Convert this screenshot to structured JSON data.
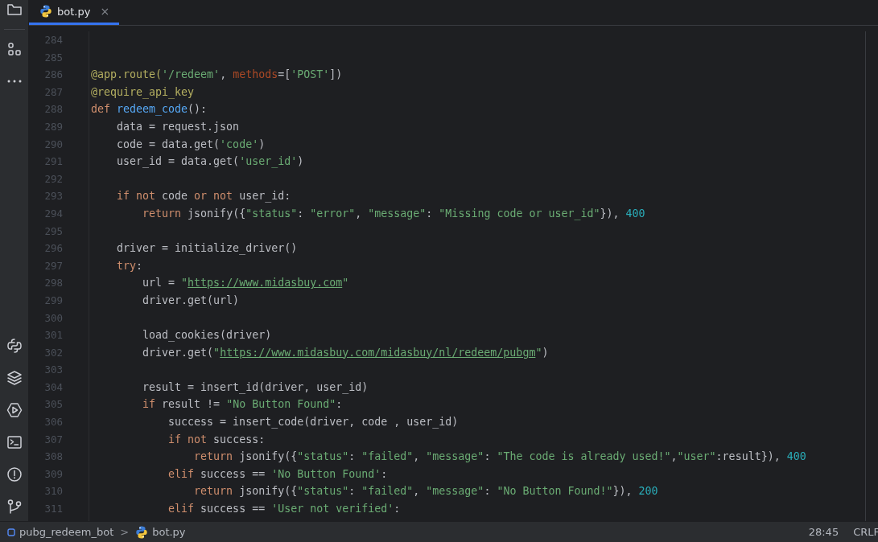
{
  "tabs": [
    {
      "label": "bot.py",
      "selected": true,
      "close": "×"
    }
  ],
  "editor": {
    "lines": [
      {
        "number": "284"
      },
      {
        "number": "285"
      },
      {
        "number": "286",
        "tokens": [
          {
            "kind": "deco",
            "text": "@app.route("
          },
          {
            "kind": "str",
            "text": "'/redeem'"
          },
          {
            "kind": "plain",
            "text": ", "
          },
          {
            "kind": "param",
            "text": "methods"
          },
          {
            "kind": "plain",
            "text": "=["
          },
          {
            "kind": "str",
            "text": "'POST'"
          },
          {
            "kind": "plain",
            "text": "])"
          }
        ]
      },
      {
        "number": "287",
        "tokens": [
          {
            "kind": "deco",
            "text": "@require_api_key"
          }
        ]
      },
      {
        "number": "288",
        "tokens": [
          {
            "kind": "kw",
            "text": "def "
          },
          {
            "kind": "fn",
            "text": "redeem_code"
          },
          {
            "kind": "plain",
            "text": "():"
          }
        ]
      },
      {
        "number": "289",
        "tokens": [
          {
            "kind": "plain",
            "text": "    data = request.json"
          }
        ]
      },
      {
        "number": "290",
        "tokens": [
          {
            "kind": "plain",
            "text": "    code = data.get("
          },
          {
            "kind": "str",
            "text": "'code'"
          },
          {
            "kind": "plain",
            "text": ")"
          }
        ]
      },
      {
        "number": "291",
        "tokens": [
          {
            "kind": "plain",
            "text": "    user_id = data.get("
          },
          {
            "kind": "str",
            "text": "'user_id'"
          },
          {
            "kind": "plain",
            "text": ")"
          }
        ]
      },
      {
        "number": "292"
      },
      {
        "number": "293",
        "tokens": [
          {
            "kind": "kw",
            "text": "    if not "
          },
          {
            "kind": "plain",
            "text": "code "
          },
          {
            "kind": "kw",
            "text": "or not "
          },
          {
            "kind": "plain",
            "text": "user_id:"
          }
        ]
      },
      {
        "number": "294",
        "tokens": [
          {
            "kind": "kw",
            "text": "        return "
          },
          {
            "kind": "plain",
            "text": "jsonify({"
          },
          {
            "kind": "str",
            "text": "\"status\""
          },
          {
            "kind": "plain",
            "text": ": "
          },
          {
            "kind": "str",
            "text": "\"error\""
          },
          {
            "kind": "plain",
            "text": ", "
          },
          {
            "kind": "str",
            "text": "\"message\""
          },
          {
            "kind": "plain",
            "text": ": "
          },
          {
            "kind": "str",
            "text": "\"Missing code or user_id\""
          },
          {
            "kind": "plain",
            "text": "}), "
          },
          {
            "kind": "num",
            "text": "400"
          }
        ]
      },
      {
        "number": "295"
      },
      {
        "number": "296",
        "tokens": [
          {
            "kind": "plain",
            "text": "    driver = initialize_driver()"
          }
        ]
      },
      {
        "number": "297",
        "tokens": [
          {
            "kind": "kw",
            "text": "    try"
          },
          {
            "kind": "plain",
            "text": ":"
          }
        ]
      },
      {
        "number": "298",
        "tokens": [
          {
            "kind": "plain",
            "text": "        url = "
          },
          {
            "kind": "str",
            "text": "\""
          },
          {
            "kind": "url",
            "text": "https://www.midasbuy.com"
          },
          {
            "kind": "str",
            "text": "\""
          }
        ]
      },
      {
        "number": "299",
        "tokens": [
          {
            "kind": "plain",
            "text": "        driver.get(url)"
          }
        ]
      },
      {
        "number": "300"
      },
      {
        "number": "301",
        "tokens": [
          {
            "kind": "plain",
            "text": "        load_cookies(driver)"
          }
        ]
      },
      {
        "number": "302",
        "tokens": [
          {
            "kind": "plain",
            "text": "        driver.get("
          },
          {
            "kind": "str",
            "text": "\""
          },
          {
            "kind": "url",
            "text": "https://www.midasbuy.com/midasbuy/nl/redeem/pubgm"
          },
          {
            "kind": "str",
            "text": "\""
          },
          {
            "kind": "plain",
            "text": ")"
          }
        ]
      },
      {
        "number": "303"
      },
      {
        "number": "304",
        "tokens": [
          {
            "kind": "plain",
            "text": "        result = insert_id(driver, user_id)"
          }
        ]
      },
      {
        "number": "305",
        "tokens": [
          {
            "kind": "kw",
            "text": "        if "
          },
          {
            "kind": "plain",
            "text": "result != "
          },
          {
            "kind": "str",
            "text": "\"No Button Found\""
          },
          {
            "kind": "plain",
            "text": ":"
          }
        ]
      },
      {
        "number": "306",
        "tokens": [
          {
            "kind": "plain",
            "text": "            success = insert_code(driver, code , user_id)"
          }
        ]
      },
      {
        "number": "307",
        "tokens": [
          {
            "kind": "kw",
            "text": "            if not "
          },
          {
            "kind": "plain",
            "text": "success:"
          }
        ]
      },
      {
        "number": "308",
        "tokens": [
          {
            "kind": "kw",
            "text": "                return "
          },
          {
            "kind": "plain",
            "text": "jsonify({"
          },
          {
            "kind": "str",
            "text": "\"status\""
          },
          {
            "kind": "plain",
            "text": ": "
          },
          {
            "kind": "str",
            "text": "\"failed\""
          },
          {
            "kind": "plain",
            "text": ", "
          },
          {
            "kind": "str",
            "text": "\"message\""
          },
          {
            "kind": "plain",
            "text": ": "
          },
          {
            "kind": "str",
            "text": "\"The code is already used!\""
          },
          {
            "kind": "plain",
            "text": ","
          },
          {
            "kind": "str",
            "text": "\"user\""
          },
          {
            "kind": "plain",
            "text": ":result}), "
          },
          {
            "kind": "num",
            "text": "400"
          }
        ]
      },
      {
        "number": "309",
        "tokens": [
          {
            "kind": "kw",
            "text": "            elif "
          },
          {
            "kind": "plain",
            "text": "success == "
          },
          {
            "kind": "str",
            "text": "'No Button Found'"
          },
          {
            "kind": "plain",
            "text": ":"
          }
        ]
      },
      {
        "number": "310",
        "tokens": [
          {
            "kind": "kw",
            "text": "                return "
          },
          {
            "kind": "plain",
            "text": "jsonify({"
          },
          {
            "kind": "str",
            "text": "\"status\""
          },
          {
            "kind": "plain",
            "text": ": "
          },
          {
            "kind": "str",
            "text": "\"failed\""
          },
          {
            "kind": "plain",
            "text": ", "
          },
          {
            "kind": "str",
            "text": "\"message\""
          },
          {
            "kind": "plain",
            "text": ": "
          },
          {
            "kind": "str",
            "text": "\"No Button Found!\""
          },
          {
            "kind": "plain",
            "text": "}), "
          },
          {
            "kind": "num",
            "text": "200"
          }
        ]
      },
      {
        "number": "311",
        "tokens": [
          {
            "kind": "kw",
            "text": "            elif "
          },
          {
            "kind": "plain",
            "text": "success == "
          },
          {
            "kind": "str",
            "text": "'User not verified'"
          },
          {
            "kind": "plain",
            "text": ":"
          }
        ]
      }
    ]
  },
  "status_bar": {
    "breadcrumbs": [
      {
        "label": "pubg_redeem_bot",
        "kind": "project"
      },
      {
        "label": "bot.py",
        "kind": "file"
      }
    ],
    "separator": ">",
    "position": "28:45",
    "line_ending": "CRLF"
  }
}
